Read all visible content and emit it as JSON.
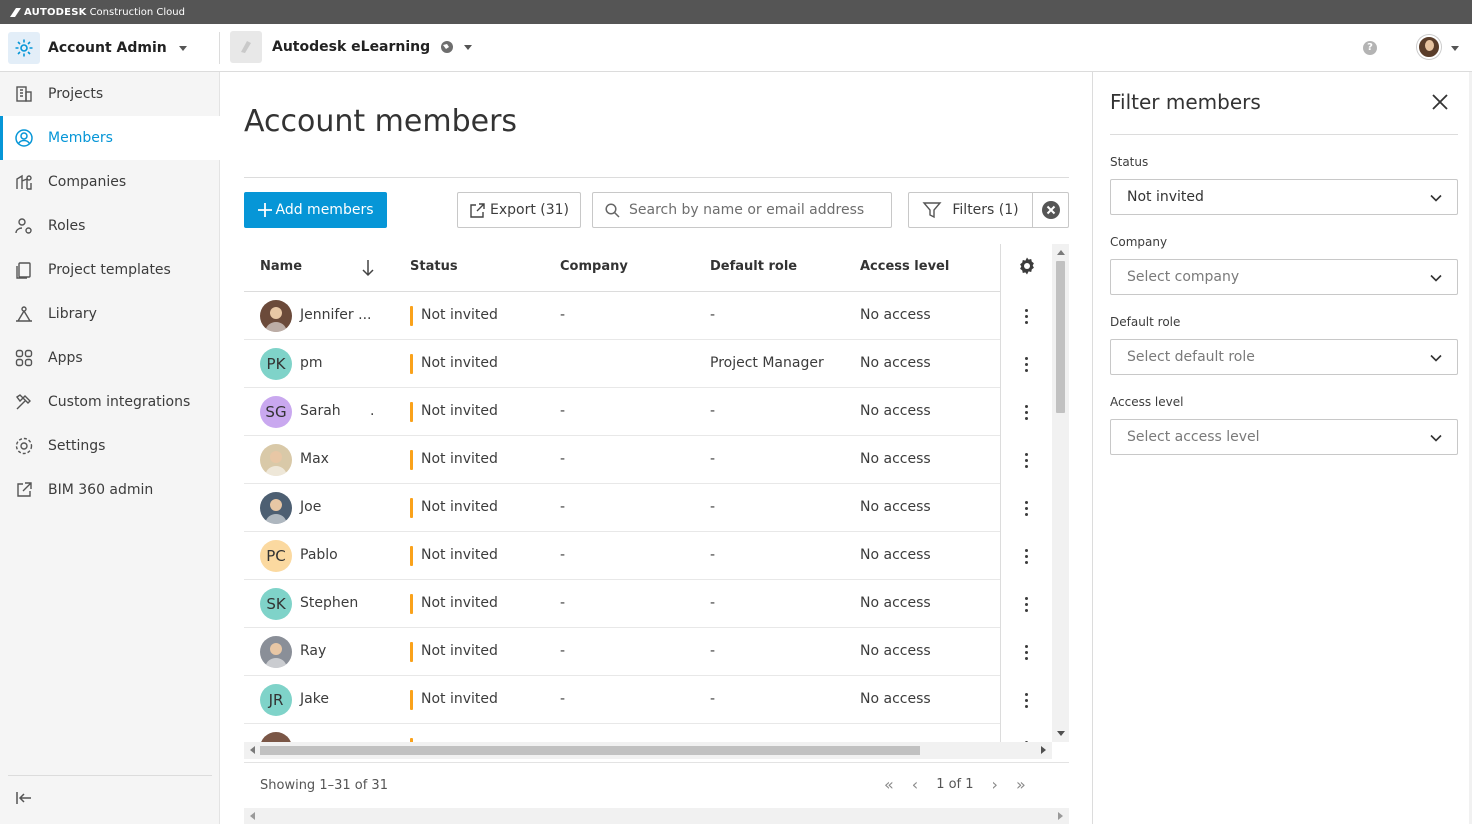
{
  "brand": {
    "logo_text": "AUTODESK",
    "product": "Construction Cloud"
  },
  "topbar": {
    "app_name": "Account Admin",
    "account_name": "Autodesk eLearning",
    "help_label": "?"
  },
  "sidebar": {
    "items": [
      {
        "label": "Projects",
        "icon": "building-icon"
      },
      {
        "label": "Members",
        "icon": "user-circle-icon",
        "active": true
      },
      {
        "label": "Companies",
        "icon": "company-icon"
      },
      {
        "label": "Roles",
        "icon": "user-gear-icon"
      },
      {
        "label": "Project templates",
        "icon": "template-icon"
      },
      {
        "label": "Library",
        "icon": "library-icon"
      },
      {
        "label": "Apps",
        "icon": "apps-grid-icon"
      },
      {
        "label": "Custom integrations",
        "icon": "tools-icon"
      },
      {
        "label": "Settings",
        "icon": "gear-icon"
      },
      {
        "label": "BIM 360 admin",
        "icon": "external-link-icon"
      }
    ]
  },
  "main": {
    "title": "Account members",
    "add_button": "Add members",
    "export_button": "Export (31)",
    "search_placeholder": "Search by name or email address",
    "filters_button": "Filters (1)",
    "columns": {
      "name": "Name",
      "status": "Status",
      "company": "Company",
      "default_role": "Default role",
      "access_level": "Access level"
    },
    "rows": [
      {
        "name": "Jennifer ...",
        "initials": "",
        "avatar_color": "#6b4a3a",
        "status": "Not invited",
        "company": "-",
        "role": "-",
        "access": "No access"
      },
      {
        "name": "pm",
        "initials": "PK",
        "avatar_color": "#7fd3c9",
        "status": "Not invited",
        "company": "",
        "role": "Project Manager",
        "access": "No access"
      },
      {
        "name": "Sarah",
        "extra": ".",
        "initials": "SG",
        "avatar_color": "#c9a8ef",
        "status": "Not invited",
        "company": "-",
        "role": "-",
        "access": "No access"
      },
      {
        "name": "Max",
        "initials": "",
        "avatar_color": "#d9c9a8",
        "status": "Not invited",
        "company": "-",
        "role": "-",
        "access": "No access"
      },
      {
        "name": "Joe",
        "initials": "",
        "avatar_color": "#4d5f72",
        "status": "Not invited",
        "company": "-",
        "role": "-",
        "access": "No access"
      },
      {
        "name": "Pablo",
        "initials": "PC",
        "avatar_color": "#fbd9a0",
        "status": "Not invited",
        "company": "-",
        "role": "-",
        "access": "No access"
      },
      {
        "name": "Stephen",
        "initials": "SK",
        "avatar_color": "#7fd3c9",
        "status": "Not invited",
        "company": "-",
        "role": "-",
        "access": "No access"
      },
      {
        "name": "Ray",
        "initials": "",
        "avatar_color": "#8a8f98",
        "status": "Not invited",
        "company": "-",
        "role": "-",
        "access": "No access"
      },
      {
        "name": "Jake",
        "initials": "JR",
        "avatar_color": "#7fd3c9",
        "status": "Not invited",
        "company": "-",
        "role": "-",
        "access": "No access"
      }
    ],
    "showing": "Showing 1–31 of 31",
    "page_indicator": "1 of 1"
  },
  "filter_panel": {
    "title": "Filter members",
    "status_label": "Status",
    "status_value": "Not invited",
    "company_label": "Company",
    "company_placeholder": "Select company",
    "role_label": "Default role",
    "role_placeholder": "Select default role",
    "access_label": "Access level",
    "access_placeholder": "Select access level"
  },
  "colors": {
    "accent": "#0696d7",
    "status_not_invited": "#faa21b"
  }
}
